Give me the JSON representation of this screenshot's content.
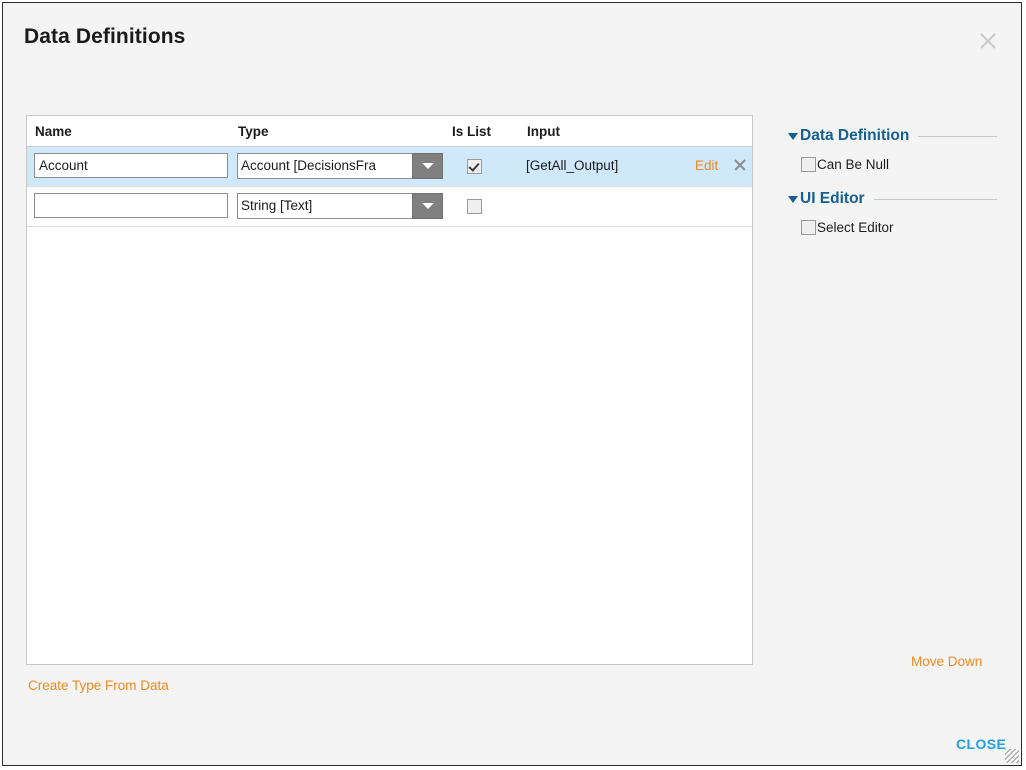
{
  "window": {
    "title": "Data Definitions",
    "close_icon": "close-icon",
    "resize_grip": "resize-grip"
  },
  "table": {
    "columns": [
      "Name",
      "Type",
      "Is List",
      "Input"
    ],
    "rows": [
      {
        "name": "Account",
        "type": "Account  [DecisionsFra",
        "is_list": true,
        "input": "[GetAll_Output]",
        "edit_label": "Edit",
        "delete_icon": "close-icon",
        "selected": true
      },
      {
        "name": "",
        "type": "String [Text]",
        "is_list": false,
        "input": "",
        "edit_label": "",
        "delete_icon": "",
        "selected": false
      }
    ]
  },
  "links": {
    "create_type_from_data": "Create Type From Data",
    "move_down": "Move Down",
    "close": "CLOSE"
  },
  "side_panel": {
    "sections": [
      {
        "title": "Data Definition",
        "options": [
          {
            "label": "Can Be Null",
            "checked": false
          }
        ]
      },
      {
        "title": "UI Editor",
        "options": [
          {
            "label": "Select Editor",
            "checked": false
          }
        ]
      }
    ]
  },
  "colors": {
    "accent_orange": "#ef8a22",
    "accent_blue": "#1fa0e0",
    "section_blue": "#15608f",
    "selected_row": "#cfe8fa",
    "dialog_bg": "#f4f4f4"
  }
}
